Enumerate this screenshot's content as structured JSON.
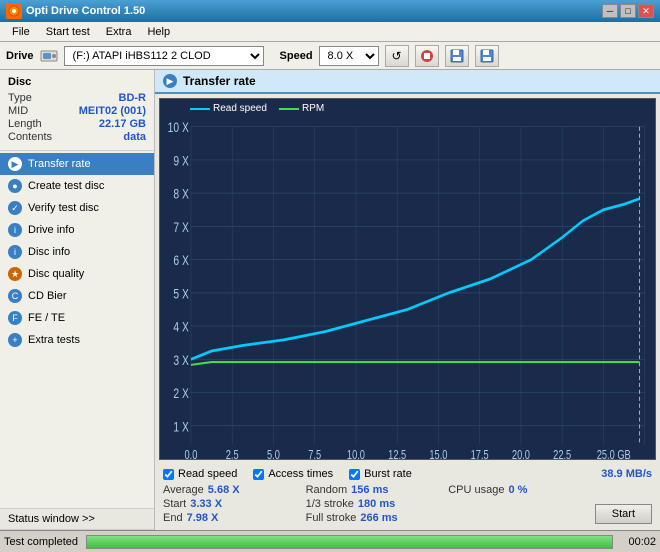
{
  "app": {
    "title": "Opti Drive Control 1.50",
    "icon": "★"
  },
  "titlebar": {
    "minimize": "─",
    "maximize": "□",
    "close": "✕"
  },
  "menubar": {
    "items": [
      "File",
      "Start test",
      "Extra",
      "Help"
    ]
  },
  "drivebar": {
    "label": "Drive",
    "drive_value": "(F:)  ATAPI iHBS112  2 CLOD",
    "speed_label": "Speed",
    "speed_value": "8.0 X",
    "icons": [
      "↺",
      "🔴",
      "💾",
      "💾"
    ]
  },
  "disc": {
    "heading": "Disc",
    "fields": [
      {
        "label": "Type",
        "value": "BD-R"
      },
      {
        "label": "MID",
        "value": "MEIT02 (001)"
      },
      {
        "label": "Length",
        "value": "22.17 GB"
      },
      {
        "label": "Contents",
        "value": "data"
      }
    ]
  },
  "nav": {
    "items": [
      {
        "id": "transfer-rate",
        "label": "Transfer rate",
        "active": true
      },
      {
        "id": "create-test-disc",
        "label": "Create test disc",
        "active": false
      },
      {
        "id": "verify-test-disc",
        "label": "Verify test disc",
        "active": false
      },
      {
        "id": "drive-info",
        "label": "Drive info",
        "active": false
      },
      {
        "id": "disc-info",
        "label": "Disc info",
        "active": false
      },
      {
        "id": "disc-quality",
        "label": "Disc quality",
        "active": false
      },
      {
        "id": "cd-bier",
        "label": "CD Bier",
        "active": false
      },
      {
        "id": "fe-te",
        "label": "FE / TE",
        "active": false
      },
      {
        "id": "extra-tests",
        "label": "Extra tests",
        "active": false
      }
    ]
  },
  "panel": {
    "title": "Transfer rate",
    "legend": {
      "read_speed": "Read speed",
      "rpm": "RPM"
    }
  },
  "chart": {
    "y_labels": [
      "10 X",
      "9 X",
      "8 X",
      "7 X",
      "6 X",
      "5 X",
      "4 X",
      "3 X",
      "2 X",
      "1 X"
    ],
    "x_labels": [
      "0.0",
      "2.5",
      "5.0",
      "7.5",
      "10.0",
      "12.5",
      "15.0",
      "17.5",
      "20.0",
      "22.5",
      "25.0 GB"
    ]
  },
  "checkboxes": [
    {
      "id": "read-speed",
      "label": "Read speed",
      "checked": true
    },
    {
      "id": "access-times",
      "label": "Access times",
      "checked": true
    },
    {
      "id": "burst-rate",
      "label": "Burst rate",
      "checked": true
    }
  ],
  "burst_rate_value": "38.9 MB/s",
  "stats": {
    "rows": [
      {
        "cols": [
          {
            "label": "Average",
            "value": "5.68 X"
          },
          {
            "label": "Random",
            "value": "156 ms"
          },
          {
            "label": "CPU usage",
            "value": "0 %"
          }
        ]
      },
      {
        "cols": [
          {
            "label": "Start",
            "value": "3.33 X"
          },
          {
            "label": "1/3 stroke",
            "value": "180 ms"
          },
          {
            "label": "",
            "value": ""
          }
        ]
      },
      {
        "cols": [
          {
            "label": "End",
            "value": "7.98 X"
          },
          {
            "label": "Full stroke",
            "value": "266 ms"
          },
          {
            "label": "",
            "value": ""
          }
        ]
      }
    ],
    "start_button": "Start"
  },
  "statusbar": {
    "status_window_label": "Status window >>",
    "test_completed": "Test completed",
    "progress": 100,
    "time": "00:02"
  }
}
